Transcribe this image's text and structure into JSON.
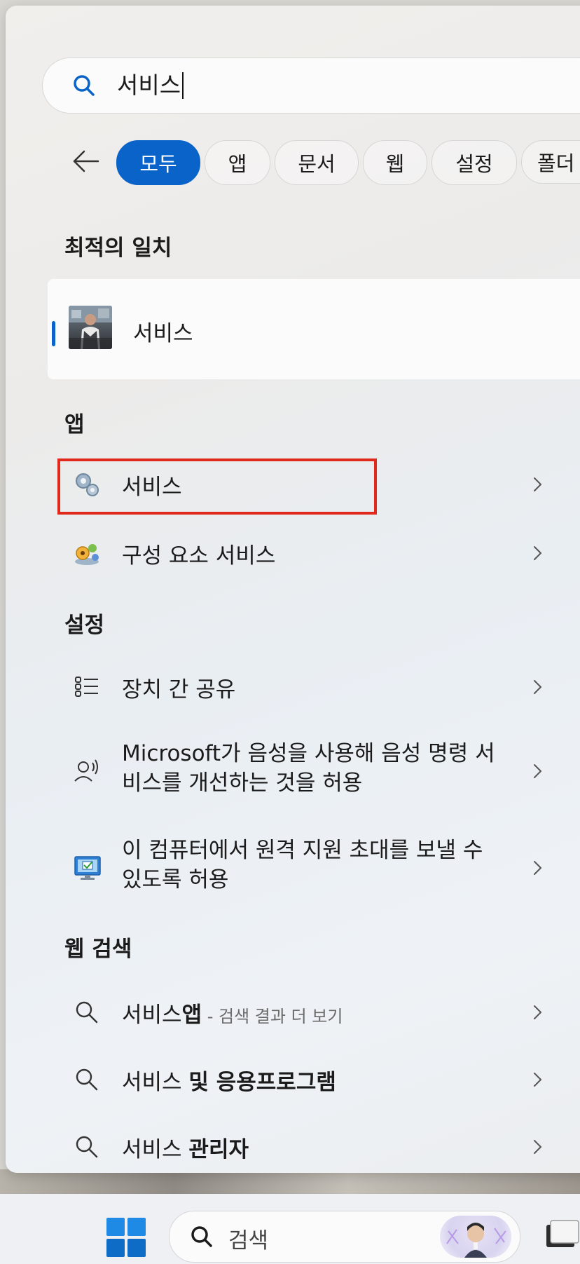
{
  "search": {
    "query": "서비스"
  },
  "filters": {
    "back_label": "←",
    "chips": [
      "모두",
      "앱",
      "문서",
      "웹",
      "설정",
      "폴더"
    ],
    "active": "모두"
  },
  "best_match": {
    "title": "최적의 일치",
    "label": "서비스"
  },
  "apps": {
    "title": "앱",
    "items": [
      {
        "label": "서비스",
        "icon": "services-gear-icon"
      },
      {
        "label": "구성 요소 서비스",
        "icon": "component-services-icon"
      }
    ]
  },
  "settings": {
    "title": "설정",
    "items": [
      {
        "label": "장치 간 공유",
        "icon": "device-sharing-icon"
      },
      {
        "label": "Microsoft가 음성을 사용해 음성 명령 서비스를 개선하는 것을 허용",
        "icon": "speech-icon"
      },
      {
        "label": "이 컴퓨터에서 원격 지원 초대를 보낼 수 있도록 허용",
        "icon": "remote-assistance-icon"
      }
    ]
  },
  "web": {
    "title": "웹 검색",
    "items": [
      {
        "prefix": "서비스",
        "bold": "앱",
        "suffix": " - 검색 결과 더 보기"
      },
      {
        "prefix": "서비스 ",
        "bold": "및 응용프로그램",
        "suffix": ""
      },
      {
        "prefix": "서비스 ",
        "bold": "관리자",
        "suffix": ""
      }
    ]
  },
  "taskbar": {
    "search_placeholder": "검색"
  },
  "colors": {
    "accent": "#0a63c9",
    "highlight_box": "#e0281b"
  }
}
